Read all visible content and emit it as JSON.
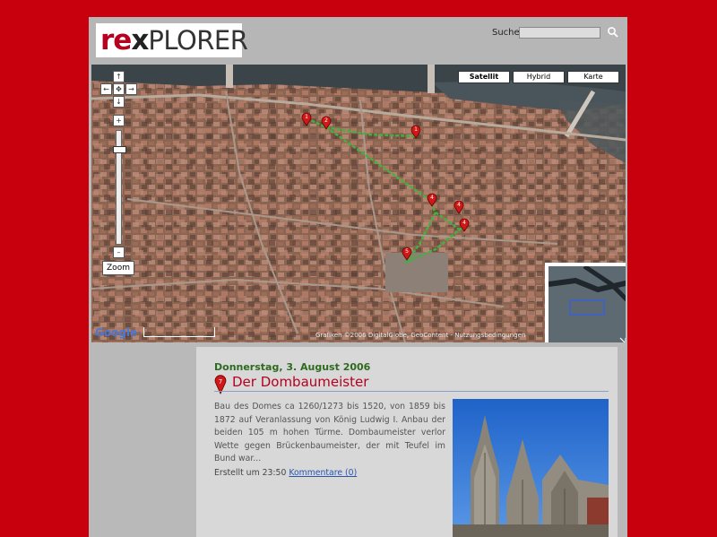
{
  "header": {
    "logo_parts": {
      "re": "re",
      "x": "x",
      "plorer": "PLORER"
    },
    "search_label": "Suche:",
    "search_value": ""
  },
  "map": {
    "types": [
      {
        "label": "Satellit",
        "active": true
      },
      {
        "label": "Hybrid",
        "active": false
      },
      {
        "label": "Karte",
        "active": false
      }
    ],
    "nav": {
      "up": "↑",
      "left": "←",
      "center": "✥",
      "right": "→",
      "down": "↓",
      "zoom_in": "+",
      "zoom_out": "–"
    },
    "zoom_label": "Zoom",
    "google_label": "Google",
    "copyright": "Grafiken ©2006 DigitalGlobe, GeoContent - Nutzungsbedingungen",
    "markers": [
      "1",
      "2",
      "1",
      "4",
      "4",
      "4",
      "5"
    ]
  },
  "post": {
    "date": "Donnerstag, 3. August 2006",
    "marker_number": "7",
    "title": "Der Dombaumeister",
    "body": "Bau des Domes ca 1260/1273 bis 1520, von 1859 bis 1872 auf Veranlassung von König Ludwig I. Anbau der beiden 105 m hohen Türme. Dombaumeister verlor Wette gegen Brückenbaumeister, der mit Teufel im Bund war...",
    "created": "Erstellt um 23:50",
    "comments": "Kommentare (0)"
  },
  "colors": {
    "brand_red": "#c8000d",
    "date_green": "#2e6b1e",
    "title_red": "#b6001f",
    "route_green": "#3fb23f"
  }
}
